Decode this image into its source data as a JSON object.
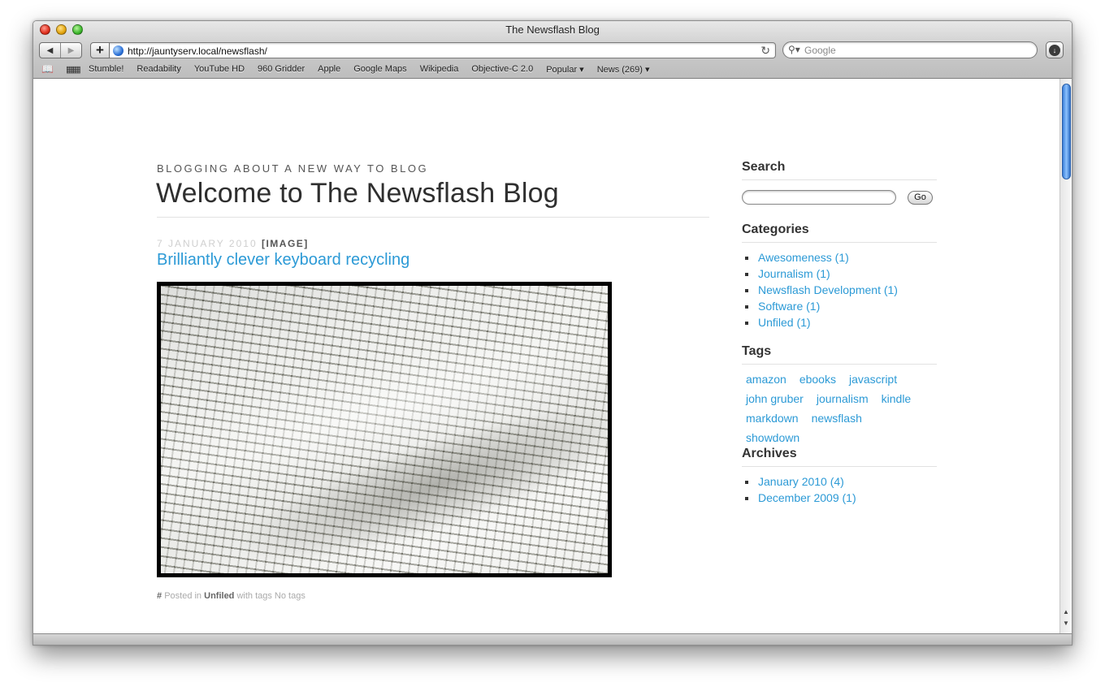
{
  "window": {
    "title": "The Newsflash Blog"
  },
  "toolbar": {
    "url": "http://jauntyserv.local/newsflash/",
    "search_placeholder": "Google",
    "back_icon": "back-arrow",
    "forward_icon": "forward-arrow",
    "add_label": "+",
    "reload_icon": "reload"
  },
  "bookmarks": [
    "Stumble!",
    "Readability",
    "YouTube HD",
    "960 Gridder",
    "Apple",
    "Google Maps",
    "Wikipedia",
    "Objective-C 2.0",
    "Popular ▾",
    "News (269) ▾"
  ],
  "blog": {
    "tagline": "BLOGGING ABOUT A NEW WAY TO BLOG",
    "title": "Welcome to The Newsflash Blog"
  },
  "post": {
    "date": "7 JANUARY 2010",
    "type": "[IMAGE]",
    "title": "Brilliantly clever keyboard recycling",
    "footer_hash": "#",
    "footer_posted": "Posted in",
    "footer_category": "Unfiled",
    "footer_tags": "with tags No tags"
  },
  "sidebar": {
    "search_heading": "Search",
    "go_label": "Go",
    "categories_heading": "Categories",
    "categories": [
      "Awesomeness (1)",
      "Journalism (1)",
      "Newsflash Development (1)",
      "Software (1)",
      "Unfiled (1)"
    ],
    "tags_heading": "Tags",
    "tags": [
      "amazon",
      "ebooks",
      "javascript",
      "john gruber",
      "journalism",
      "kindle",
      "markdown",
      "newsflash",
      "showdown"
    ],
    "archives_heading": "Archives",
    "archives": [
      "January 2010 (4)",
      "December 2009 (1)"
    ]
  }
}
